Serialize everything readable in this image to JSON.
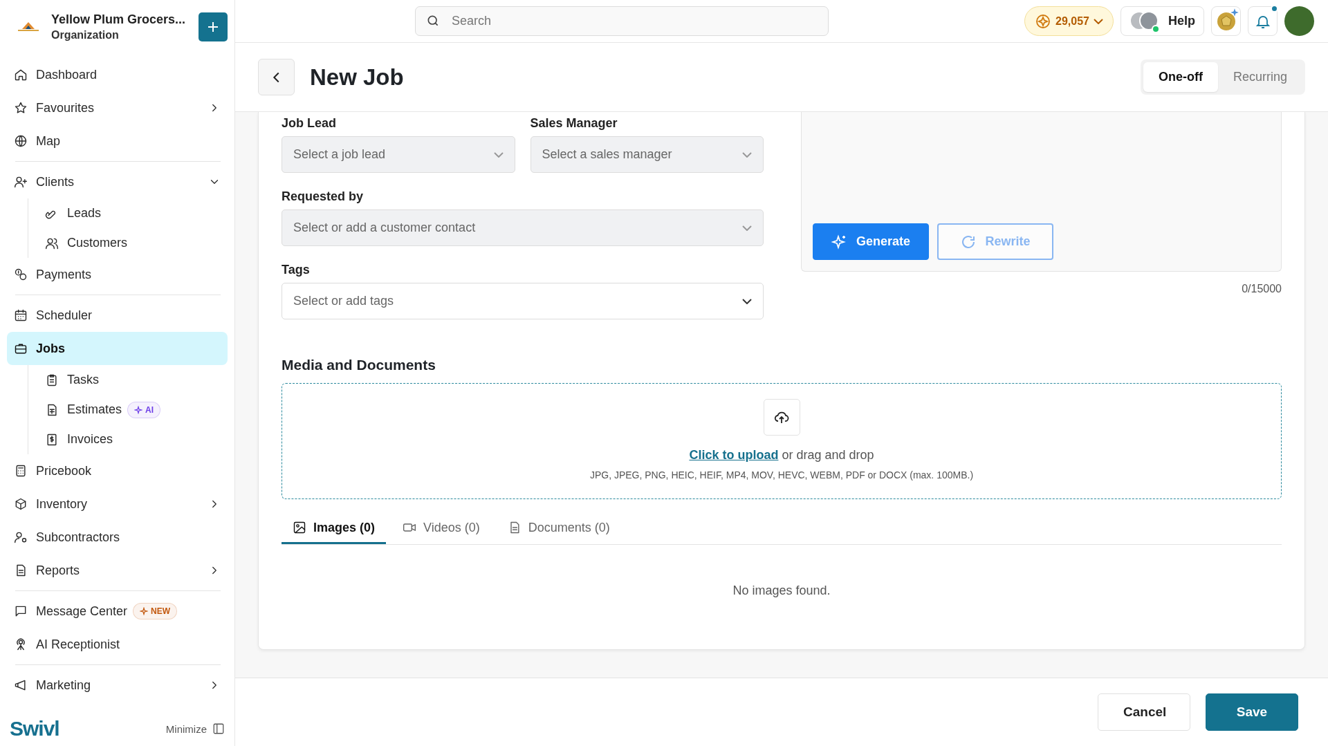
{
  "sidebar": {
    "org": {
      "name": "Yellow Plum Grocers...",
      "type": "Organization"
    },
    "items": [
      {
        "label": "Dashboard",
        "selected": false
      },
      {
        "label": "Favourites",
        "selected": false,
        "expanded": false
      },
      {
        "label": "Map",
        "selected": false,
        "divider_after": true
      },
      {
        "label": "Clients",
        "selected": false,
        "expanded": true,
        "children": [
          {
            "label": "Leads",
            "selected": false
          },
          {
            "label": "Customers",
            "selected": false
          }
        ]
      },
      {
        "label": "Payments",
        "selected": false,
        "divider_after": true
      },
      {
        "label": "Scheduler",
        "selected": false
      },
      {
        "label": "Jobs",
        "selected": true,
        "children": [
          {
            "label": "Tasks",
            "selected": false
          },
          {
            "label": "Estimates",
            "selected": false,
            "badge": {
              "text": "AI",
              "color": "#6d3ee8"
            }
          },
          {
            "label": "Invoices",
            "selected": false
          }
        ]
      },
      {
        "label": "Pricebook",
        "selected": false
      },
      {
        "label": "Inventory",
        "selected": false,
        "expanded": false
      },
      {
        "label": "Subcontractors",
        "selected": false
      },
      {
        "label": "Reports",
        "selected": false,
        "expanded": false,
        "divider_after": true
      },
      {
        "label": "Message Center",
        "selected": false,
        "badge": {
          "text": "NEW",
          "color": "#c2570c"
        }
      },
      {
        "label": "AI Receptionist",
        "selected": false,
        "divider_after": true
      },
      {
        "label": "Marketing",
        "selected": false,
        "expanded": false
      }
    ],
    "logo": "Swivl",
    "minimize": "Minimize"
  },
  "topbar": {
    "search": {
      "placeholder": "Search"
    },
    "points": "29,057",
    "help": {
      "label": "Help",
      "online": true
    },
    "notifications": {
      "unread": true
    }
  },
  "header": {
    "title": "New Job",
    "modes": [
      {
        "label": "One-off",
        "selected": true
      },
      {
        "label": "Recurring",
        "selected": false
      }
    ]
  },
  "form": {
    "rows": [
      [
        {
          "label": "Job Lead",
          "placeholder": "Select a job lead",
          "disabled": true
        },
        {
          "label": "Sales Manager",
          "placeholder": "Select a sales manager",
          "disabled": true
        }
      ],
      [
        {
          "label": "Requested by",
          "placeholder": "Select or add a customer contact",
          "disabled": true
        }
      ],
      [
        {
          "label": "Tags",
          "placeholder": "Select or add tags",
          "disabled": false
        }
      ]
    ]
  },
  "description": {
    "buttons": [
      {
        "label": "Generate",
        "kind": "generate",
        "disabled": false
      },
      {
        "label": "Rewrite",
        "kind": "rewrite",
        "disabled": true
      }
    ],
    "counter": "0/15000"
  },
  "media": {
    "title": "Media and Documents",
    "upload_link": "Click to upload",
    "upload_text": "or drag and drop",
    "formats": "JPG, JPEG, PNG, HEIC, HEIF, MP4, MOV, HEVC, WEBM, PDF or DOCX (max. 100MB.)",
    "tabs": [
      {
        "label": "Images (0)",
        "kind": "image",
        "selected": true
      },
      {
        "label": "Videos (0)",
        "kind": "video",
        "selected": false
      },
      {
        "label": "Documents (0)",
        "kind": "document",
        "selected": false
      }
    ],
    "empty": "No images found."
  },
  "footer": {
    "buttons": [
      {
        "label": "Cancel",
        "kind": "secondary"
      },
      {
        "label": "Save",
        "kind": "primary"
      }
    ]
  }
}
